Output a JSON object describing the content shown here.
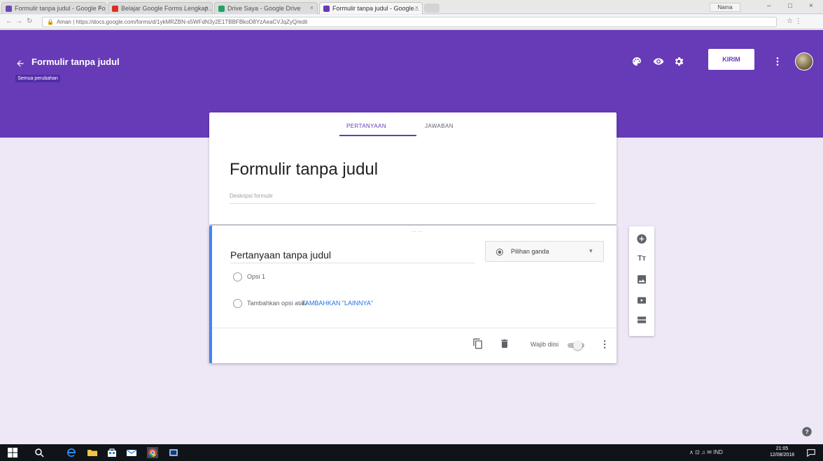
{
  "browser": {
    "tabs": [
      {
        "label": "Formulir tanpa judul - Google Fo...",
        "favicon_color": "#6a4ab0"
      },
      {
        "label": "Belajar Google Forms Lengkap...",
        "favicon_color": "#d93025"
      },
      {
        "label": "Drive Saya - Google Drive",
        "favicon_color": "#1fa463"
      },
      {
        "label": "Formulir tanpa judul - Google...",
        "favicon_color": "#673ab7",
        "active": true
      }
    ],
    "profile_label": "Nama",
    "address": "https://docs.google.com/forms/d/1ykMRZBN-s5WFdN3y2E1TBBFBkoD8YzAeaCVJqZyQ/edit",
    "secure_label": "Aman"
  },
  "header": {
    "title": "Formulir tanpa judul",
    "saved_badge": "Semua perubahan disimpan",
    "send_label": "KIRIM",
    "bg_color": "#673ab7"
  },
  "form": {
    "tab_questions": "PERTANYAAN",
    "tab_responses": "JAWABAN",
    "title": "Formulir tanpa judul",
    "description_placeholder": "Deskripsi formulir"
  },
  "question": {
    "title": "Pertanyaan tanpa judul",
    "type_label": "Pilihan ganda",
    "option1": "Opsi 1",
    "add_option": "Tambahkan opsi",
    "add_other_prefix": "atau",
    "add_other": "TAMBAHKAN \"LAINNYA\"",
    "required_label": "Wajib diisi"
  },
  "taskbar": {
    "tray": "∧ ⊡ ♫ ✉ IND",
    "time": "21:05",
    "date": "12/08/2018"
  }
}
